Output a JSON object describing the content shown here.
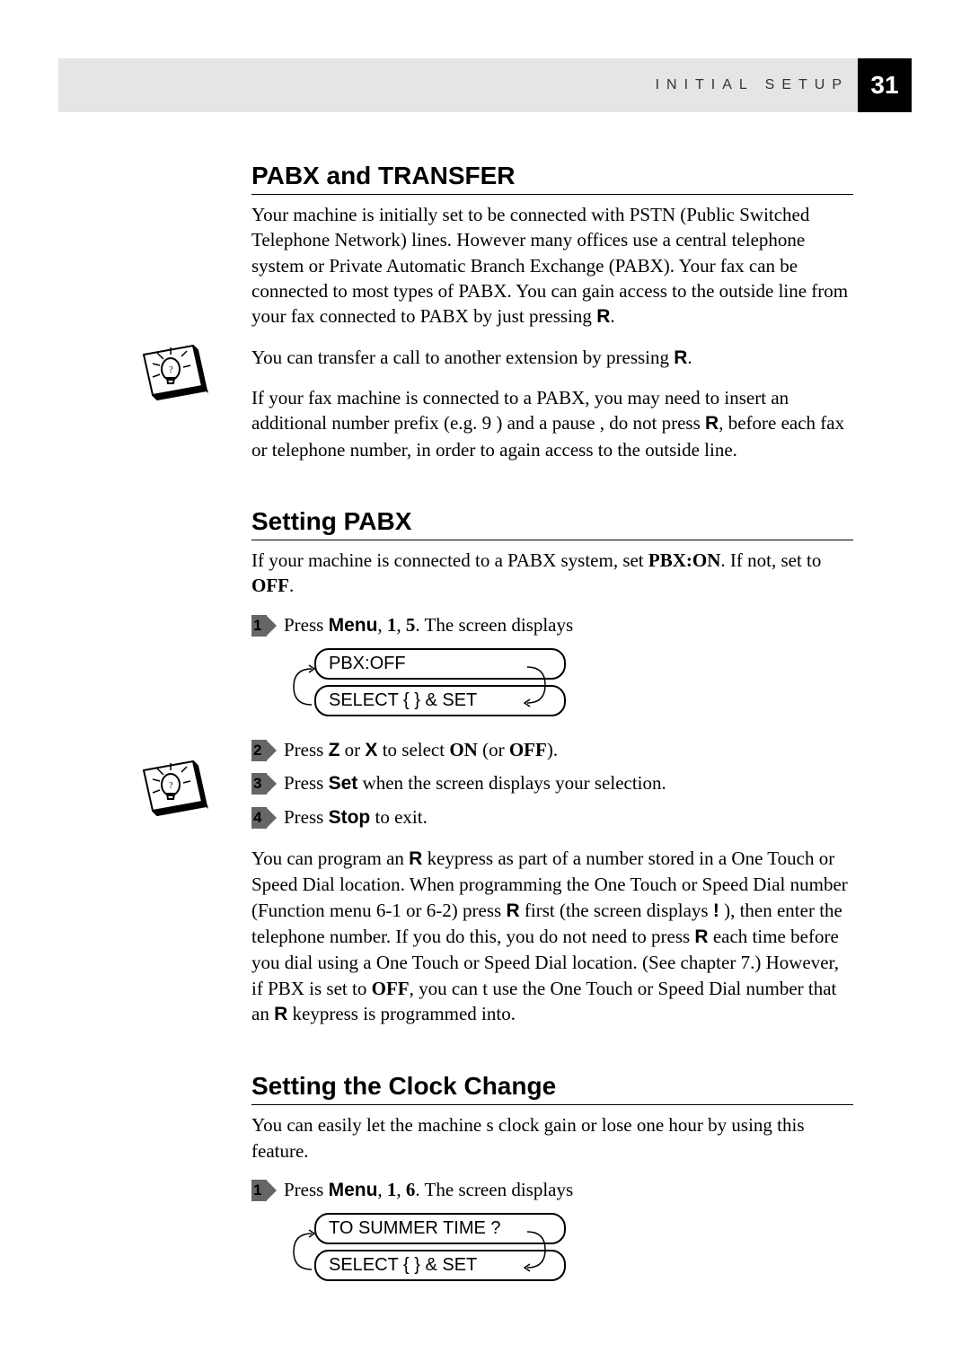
{
  "header": {
    "section_label": "INITIAL SETUP",
    "page_number": "31"
  },
  "section1": {
    "heading": "PABX and TRANSFER",
    "para1_a": "Your machine is initially set to be connected with PSTN (Public Switched Telephone Network) lines. However many offices use a central telephone system or Private Automatic Branch Exchange (PABX). Your fax can be connected to most types of PABX. You can gain access to the outside line from your fax connected to PABX by just pressing ",
    "para1_key": "R",
    "para1_end": ".",
    "tip1_a": "You can transfer a call to another extension by pressing ",
    "tip1_key": "R",
    "tip1_end": ".",
    "tip2_a": "If your fax machine is connected to a PABX, you may need to insert an additional number prefix (e.g.  9 ) and a  pause , do not press   ",
    "tip2_key": "R",
    "tip2_b": ", before each fax or telephone number, in order to again access to the outside line."
  },
  "section2": {
    "heading": "Setting PABX",
    "intro_a": "If your machine is connected to a PABX system, set ",
    "intro_b": "PBX:ON",
    "intro_c": ". If not, set to ",
    "intro_d": "OFF",
    "intro_e": ".",
    "step1_a": "Press ",
    "step1_b": "Menu",
    "step1_c": ", ",
    "step1_d": "1",
    "step1_e": ", ",
    "step1_f": "5",
    "step1_g": ". The screen displays",
    "display1": "PBX:OFF",
    "display2": "SELECT { } & SET",
    "step2_a": "Press ",
    "step2_z": "Z",
    "step2_or": "    or ",
    "step2_x": "X",
    "step2_b": "    to select ",
    "step2_on": "ON",
    "step2_c": " (or ",
    "step2_off": "OFF",
    "step2_d": ").",
    "step3_a": "Press ",
    "step3_set": "Set",
    "step3_b": " when the screen displays your selection.",
    "step4_a": "Press ",
    "step4_stop": "Stop",
    "step4_b": " to exit.",
    "tip_a": "You can program an ",
    "tip_r1": "R",
    "tip_b": " keypress as part of a number stored in a One Touch or Speed Dial location. When programming the One Touch or Speed Dial number (Function menu 6-1 or 6-2) press ",
    "tip_r2": "R",
    "tip_c": " first (the screen displays  ",
    "tip_excl": "!",
    "tip_d": " ), then enter the telephone number. If you do this, you do not need to press ",
    "tip_r3": "R",
    "tip_e": " each time before you dial using a One Touch or Speed Dial location. (See chapter 7.) However, if PBX is set to ",
    "tip_off": "OFF",
    "tip_f": ", you can t use the One Touch or Speed Dial number that an ",
    "tip_r4": "R",
    "tip_g": " keypress is programmed into."
  },
  "section3": {
    "heading": "Setting the Clock Change",
    "intro": "You can easily let the machine s clock gain or lose one hour by using this feature.",
    "step1_a": "Press ",
    "step1_b": "Menu",
    "step1_c": ", ",
    "step1_d": "1",
    "step1_e": ", ",
    "step1_f": "6",
    "step1_g": ". The screen displays",
    "display1": "TO SUMMER TIME ?",
    "display2": "SELECT { } & SET"
  },
  "step_numbers": {
    "n1": "1",
    "n2": "2",
    "n3": "3",
    "n4": "4"
  }
}
